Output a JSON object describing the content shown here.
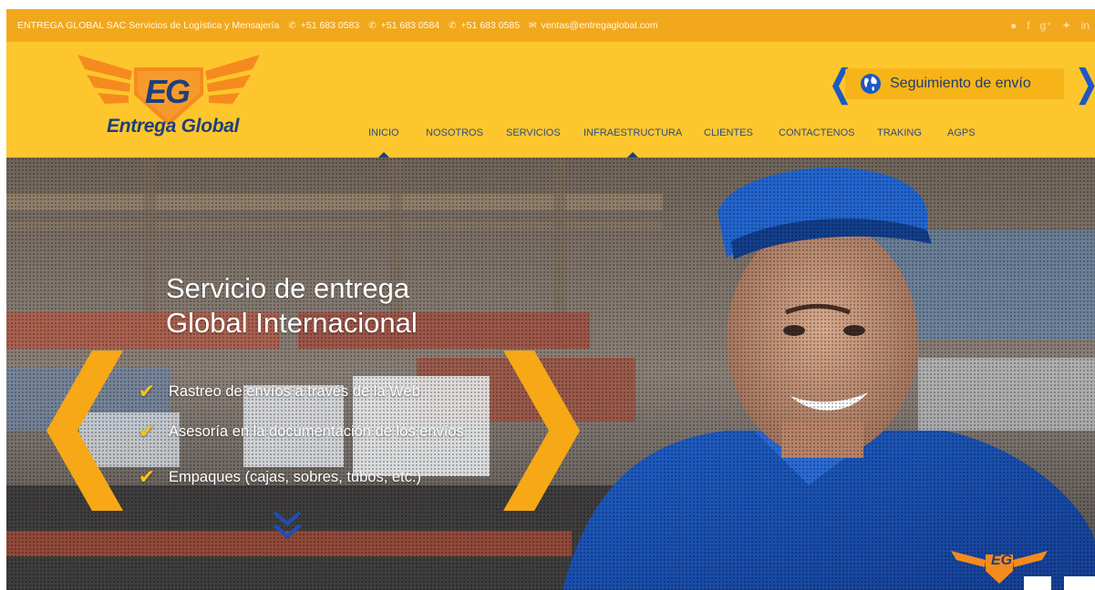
{
  "topbar": {
    "company": "ENTREGA GLOBAL SAC Servicios de Logística y Mensajería",
    "phones": [
      "+51 683 0583",
      "+51 683 0584",
      "+51 683 0585"
    ],
    "email": "ventas@entregaglobal.com",
    "social_icons": [
      "skype-icon",
      "facebook-icon",
      "google-plus-icon",
      "twitter-icon",
      "linkedin-icon"
    ]
  },
  "header": {
    "logo_monogram": "EG",
    "logo_text": "Entrega Global",
    "tracking_label": "Seguimiento de envío"
  },
  "nav": {
    "items": [
      "INICIO",
      "NOSOTROS",
      "SERVICIOS",
      "INFRAESTRUCTURA",
      "CLIENTES",
      "CONTACTENOS",
      "TRAKING",
      "AGPS"
    ],
    "active": "INICIO"
  },
  "hero": {
    "title_line1": "Servicio de entrega",
    "title_line2": "Global Internacional",
    "bullets": [
      "Rastreo de envíos a través de la Web",
      "Asesoría en la documentación de los envíos",
      "Empaques (cajas, sobres, tubos, etc.)"
    ],
    "cap_logo": "EG"
  },
  "colors": {
    "topbar": "#f2a81d",
    "header": "#fec62d",
    "nav_text": "#2b4d86",
    "accent_blue": "#1d58c4",
    "slider_arrow": "#f6a816"
  }
}
